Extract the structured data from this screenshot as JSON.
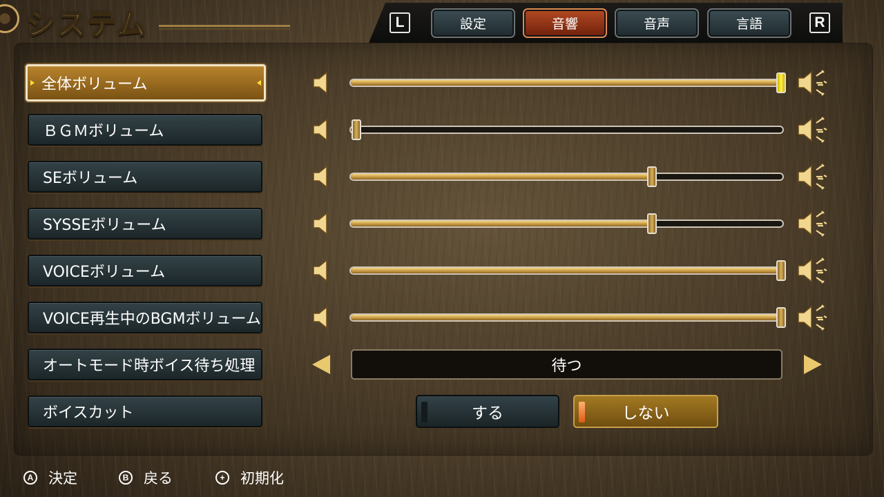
{
  "title": "システム",
  "tabs": {
    "left_key": "L",
    "right_key": "R",
    "items": [
      {
        "label": "設定",
        "active": false
      },
      {
        "label": "音響",
        "active": true
      },
      {
        "label": "音声",
        "active": false
      },
      {
        "label": "言語",
        "active": false
      }
    ]
  },
  "settings": {
    "master": {
      "label": "全体ボリューム",
      "value_fraction": 1.0
    },
    "bgm": {
      "label": "ＢＧＭボリューム",
      "value_fraction": 0.0
    },
    "se": {
      "label": "SEボリューム",
      "value_fraction": 0.7
    },
    "sysse": {
      "label": "SYSSEボリューム",
      "value_fraction": 0.7
    },
    "voice": {
      "label": "VOICEボリューム",
      "value_fraction": 1.0
    },
    "voice_bgm": {
      "label": "VOICE再生中のBGMボリューム",
      "value_fraction": 1.0
    },
    "auto_mode_wait": {
      "label": "オートモード時ボイス待ち処理",
      "value": "待つ"
    },
    "voice_cut": {
      "label": "ボイスカット",
      "option_on": "する",
      "option_off": "しない",
      "selected": "しない"
    }
  },
  "footer": {
    "confirm": {
      "icon": "A",
      "label": "決定"
    },
    "back": {
      "icon": "B",
      "label": "戻る"
    },
    "reset": {
      "icon": "+",
      "label": "初期化"
    }
  },
  "colors": {
    "accent_gold": "#b8832c",
    "active_tab": "#b44a22",
    "button_dark": "#334247"
  }
}
